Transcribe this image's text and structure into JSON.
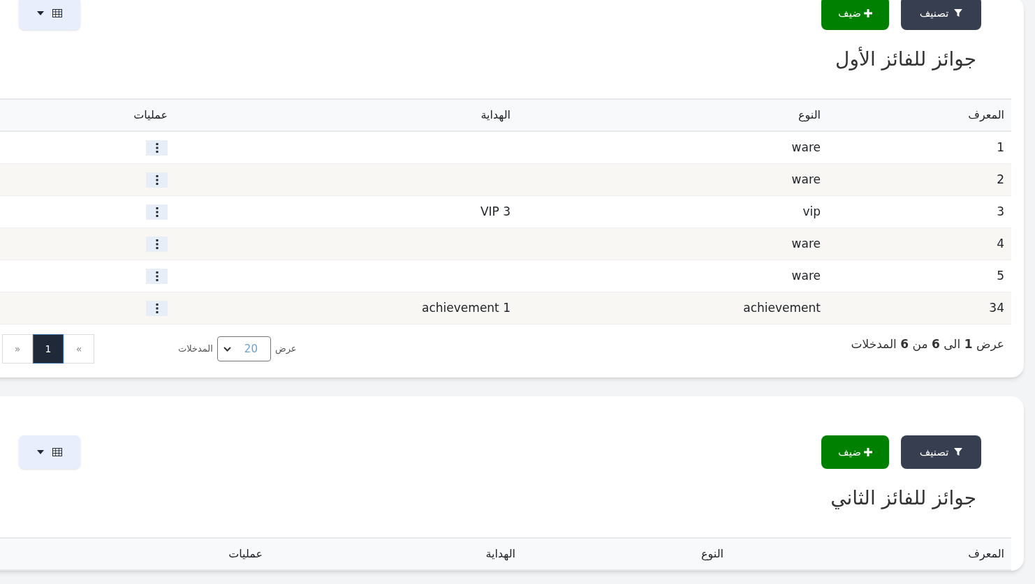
{
  "sections": [
    {
      "title": "جوائز للفائز الأول",
      "buttons": [
        {
          "kind": "filter",
          "label": "تصنيف"
        },
        {
          "kind": "add",
          "label": "ضيف"
        }
      ],
      "table": {
        "columns": [
          "المعرف",
          "النوع",
          "الهداية",
          "عمليات"
        ],
        "rows": [
          {
            "id": "1",
            "type": "ware"
          },
          {
            "id": "2",
            "type": "ware"
          },
          {
            "id": "3",
            "type": "vip",
            "gift": "VIP 3"
          },
          {
            "id": "4",
            "type": "ware"
          },
          {
            "id": "5",
            "type": "ware"
          },
          {
            "id": "34",
            "type": "achievement",
            "gift": "achievement 1"
          }
        ]
      },
      "footer": {
        "info": "عرض **1** الى **6** من **6** المدخلات",
        "show_label": "عرض",
        "page_size": "20",
        "entries_label": "المدخلات",
        "pages": [
          {
            "label": "»",
            "selected": false
          },
          {
            "label": "1",
            "selected": true
          },
          {
            "label": "«",
            "selected": false
          }
        ]
      }
    },
    {
      "title": "جوائز للفائز الثاني",
      "buttons": [
        {
          "kind": "filter",
          "label": "تصنيف"
        },
        {
          "kind": "add",
          "label": "ضيف"
        }
      ],
      "table": {
        "columns": [
          "المعرف",
          "النوع",
          "الهداية",
          "عمليات"
        ]
      }
    }
  ]
}
